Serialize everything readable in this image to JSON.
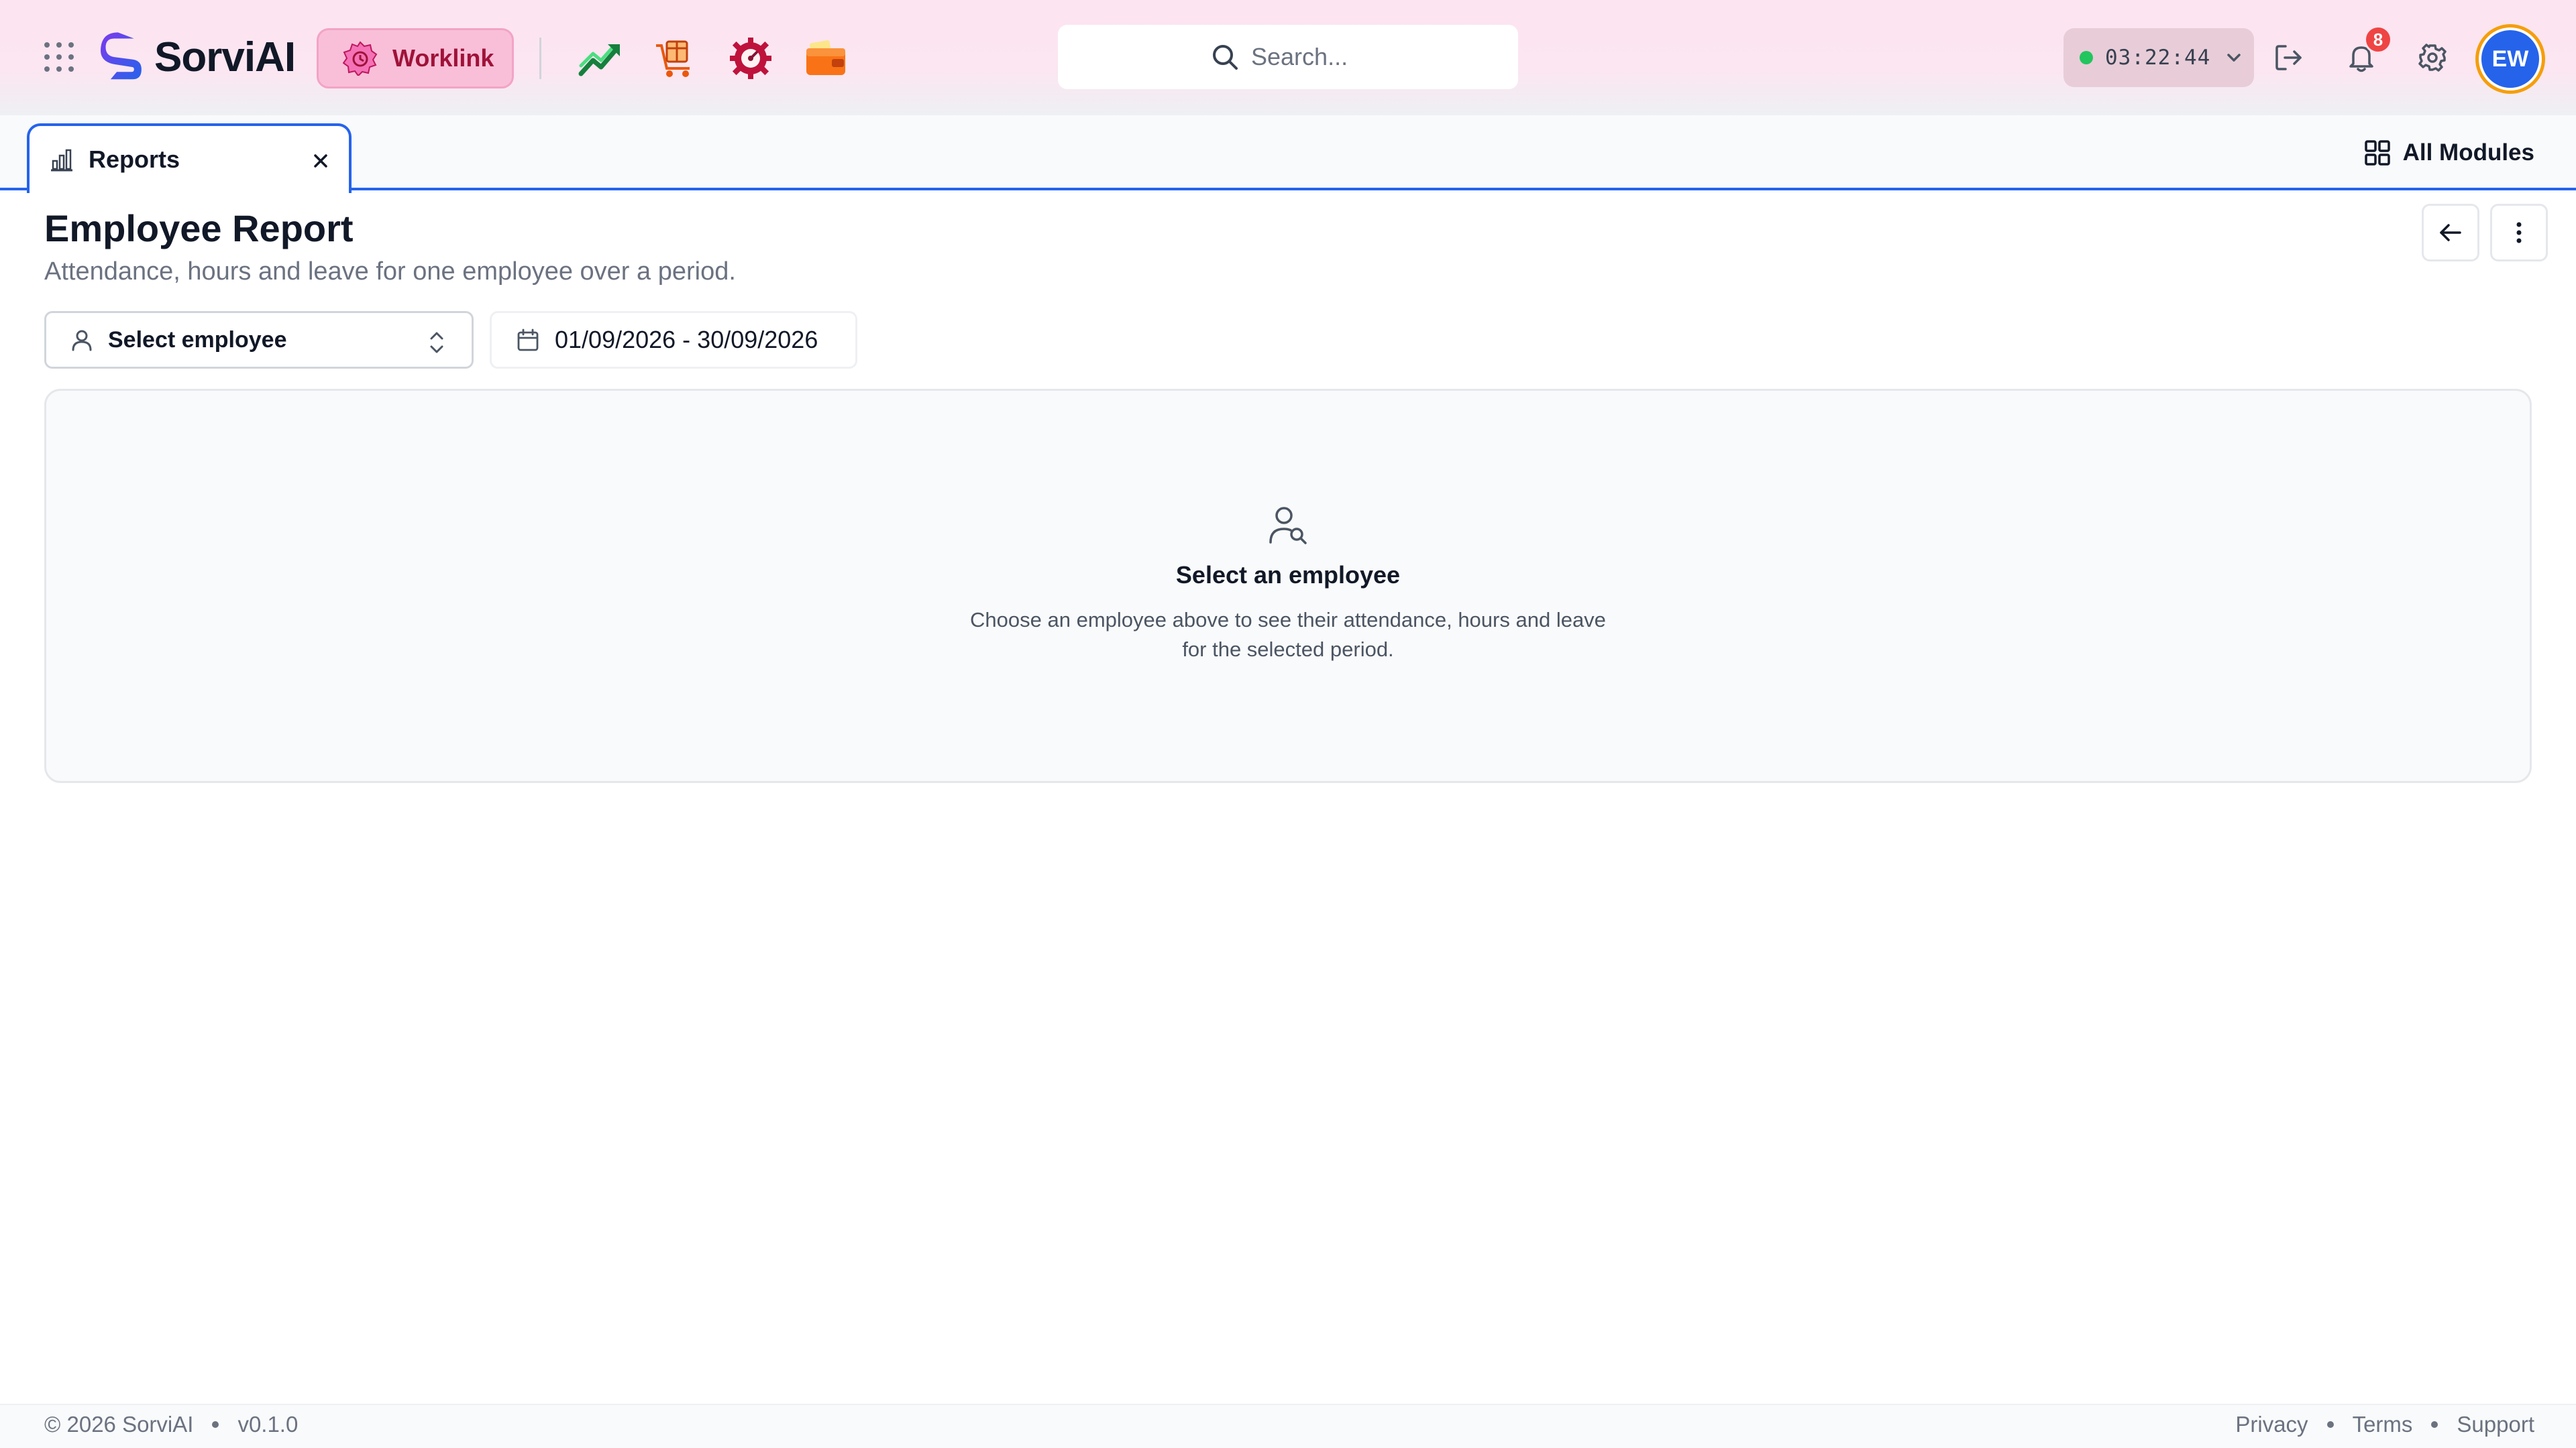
{
  "header": {
    "brand": "SorviAI",
    "active_app": "Worklink",
    "app_shortcuts": [
      "trend-chart-icon",
      "box-cart-icon",
      "gear-gauge-icon",
      "wallet-icon"
    ],
    "search_placeholder": "Search...",
    "timer": {
      "time": "03:22:44",
      "status_color": "#22c55e"
    },
    "notifications_count": "8",
    "avatar_initials": "EW"
  },
  "tabs": {
    "items": [
      {
        "label": "Reports",
        "icon": "bar-chart-icon"
      }
    ],
    "all_modules_label": "All Modules"
  },
  "page": {
    "title": "Employee Report",
    "subtitle": "Attendance, hours and leave for one employee over a period.",
    "employee_select": {
      "value": "Select employee"
    },
    "date_range": "01/09/2026 - 30/09/2026",
    "empty_state": {
      "title": "Select an employee",
      "description": "Choose an employee above to see their attendance, hours and leave for the selected period."
    }
  },
  "footer": {
    "copyright": "© 2026 SorviAI",
    "version": "v0.1.0",
    "links": [
      "Privacy",
      "Terms",
      "Support"
    ]
  },
  "colors": {
    "accent": "#2563eb",
    "worklink_pill": "#f9bfd8",
    "badge": "#ef4444"
  }
}
